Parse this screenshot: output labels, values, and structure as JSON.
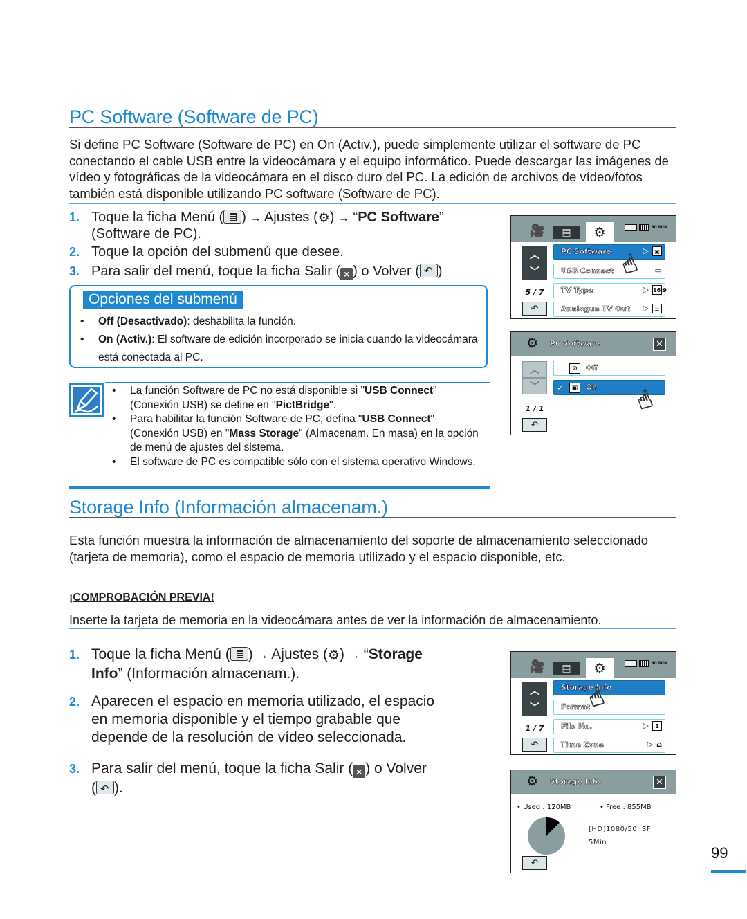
{
  "section1": {
    "title": "PC Software (Software de PC)",
    "intro": "Si define PC Software (Software de PC) en On (Activ.), puede simplemente utilizar el software de PC conectando el cable USB entre la videocámara y el equipo informático. Puede descargar las imágenes de vídeo y fotográficas de la videocámara en el disco duro del PC. La edición de archivos de vídeo/fotos también está disponible utilizando PC software (Software de PC).",
    "steps": [
      {
        "num": "1.",
        "text_a": "Toque la ficha Menú (",
        "text_b": ") ",
        "arrow": "→",
        "text_c": " Ajustes (",
        "text_d": ") ",
        "text_e": " “",
        "bold": "PC Software",
        "text_f": "”",
        "line2": "(Software de PC)."
      },
      {
        "num": "2.",
        "text": "Toque la opción del submenú que desee."
      },
      {
        "num": "3.",
        "text_a": "Para salir del menú, toque la ficha Salir (",
        "text_b": ") o Volver (",
        "text_c": ")"
      }
    ],
    "submenu": {
      "header": "Opciones del submenú",
      "items": [
        {
          "bold": "Off (Desactivado)",
          "text": ": deshabilita la función."
        },
        {
          "bold": "On (Activ.)",
          "text": ": El software de edición incorporado se inicia cuando la videocámara está conectada al PC."
        }
      ]
    },
    "notes": [
      {
        "parts": [
          "La función Software de PC no está disponible si \"",
          "USB Connect",
          "\" (Conexión USB) se define en \"",
          "PictBridge",
          "\"."
        ]
      },
      {
        "parts": [
          "Para habilitar la función Software de PC, defina \"",
          "USB Connect",
          "\" (Conexión USB) en \"",
          "Mass Storage",
          "\" (Almacenam. En masa) en la opción de menú de ajustes del sistema."
        ]
      },
      {
        "parts": [
          "El software de PC es compatible sólo con el sistema operativo Windows."
        ]
      }
    ],
    "screen1": {
      "page": "5 / 7",
      "items": [
        {
          "label": "PC Software",
          "selected": true
        },
        {
          "label": "USB Connect",
          "selected": false
        },
        {
          "label": "TV Type",
          "selected": false
        },
        {
          "label": "Analogue TV Out",
          "selected": false
        }
      ],
      "status_min": "90 MIN"
    },
    "screen2": {
      "title": "PC Software",
      "page": "1 / 1",
      "options": [
        {
          "label": "Off",
          "selected": false
        },
        {
          "label": "On",
          "selected": true
        }
      ]
    }
  },
  "section2": {
    "title": "Storage Info (Información almacenam.)",
    "intro": "Esta función muestra la información de almacenamiento del soporte de almacenamiento seleccionado (tarjeta de memoria), como el espacio de memoria utilizado y el espacio disponible, etc.",
    "precheck_title": "¡COMPROBACIÓN PREVIA!",
    "precheck_text": "Inserte la tarjeta de memoria en la videocámara antes de ver la información de almacenamiento.",
    "steps": [
      {
        "num": "1.",
        "text_a": "Toque la ficha Menú (",
        "text_b": ") ",
        "arrow": "→",
        "text_c": " Ajustes (",
        "text_d": ") ",
        "text_e": " “",
        "bold": "Storage",
        "bold2": "Info",
        "text_f": "” (Información almacenam.)."
      },
      {
        "num": "2.",
        "line1": "Aparecen el espacio en memoria utilizado, el espacio",
        "line2": "en memoria disponible y el tiempo grabable que",
        "line3": "depende de la resolución de vídeo seleccionada."
      },
      {
        "num": "3.",
        "text_a": "Para salir del menú, toque la ficha Salir (",
        "text_b": ") o Volver",
        "text_c": "(",
        "text_d": ")."
      }
    ],
    "screen3": {
      "page": "1 / 7",
      "items": [
        {
          "label": "Storage Info",
          "selected": true
        },
        {
          "label": "Format",
          "selected": false
        },
        {
          "label": "File No.",
          "selected": false
        },
        {
          "label": "Time Zone",
          "selected": false
        }
      ]
    },
    "screen4": {
      "title": "Storage Info",
      "used_label": "• Used : ",
      "used_value": "120MB",
      "free_label": "• Free : ",
      "free_value": "855MB",
      "used_fraction": 0.123,
      "resolution": "[HD]1080/50i SF",
      "remaining": "5Min"
    }
  },
  "page_number": "99",
  "colors": {
    "accent": "#1e88d0",
    "screen_header": "#8a9ea0",
    "selected_item": "#1e7ec6"
  }
}
